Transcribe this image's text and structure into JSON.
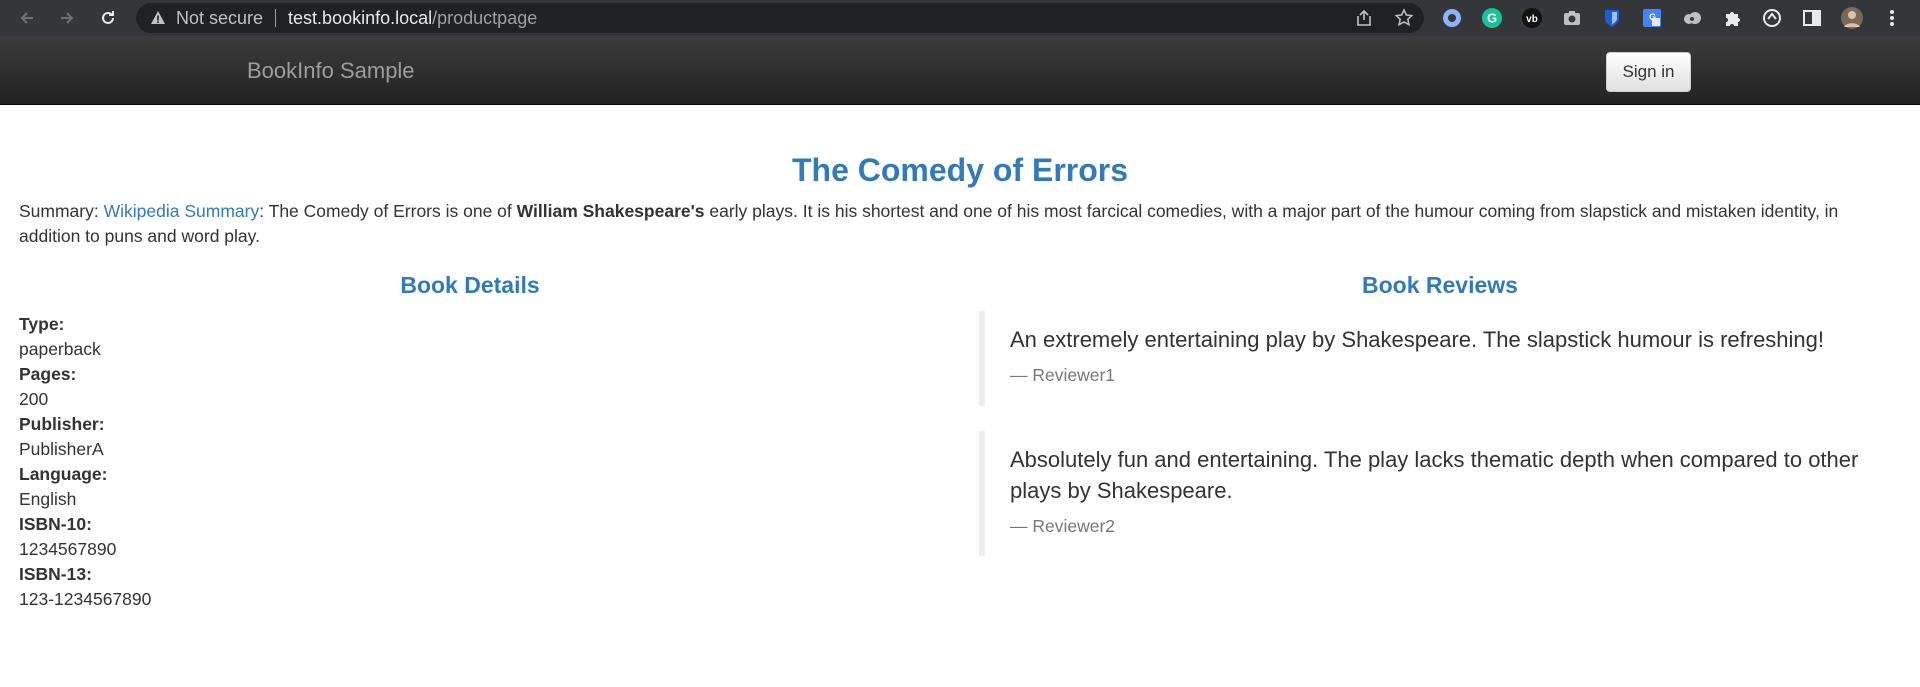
{
  "browser": {
    "not_secure_label": "Not secure",
    "url_host": "test.bookinfo.local",
    "url_path": "/productpage",
    "extension_icons": [
      "privacy-badger-icon",
      "grammarly-icon",
      "vidiq-icon",
      "camera-icon",
      "bitwarden-icon",
      "google-translate-icon",
      "cloud-extension-icon",
      "puzzle-extensions-icon",
      "sync-icon",
      "side-panel-icon",
      "profile-avatar",
      "more-menu-icon"
    ]
  },
  "navbar": {
    "brand": "BookInfo Sample",
    "sign_in_label": "Sign in"
  },
  "product": {
    "title": "The Comedy of Errors",
    "summary_prefix": "Summary: ",
    "summary_link": "Wikipedia Summary",
    "summary_text_1": ": The Comedy of Errors is one of ",
    "summary_bold": "William Shakespeare's",
    "summary_text_2": " early plays. It is his shortest and one of his most farcical comedies, with a major part of the humour coming from slapstick and mistaken identity, in addition to puns and word play."
  },
  "details": {
    "heading": "Book Details",
    "items": [
      {
        "label": "Type:",
        "value": "paperback"
      },
      {
        "label": "Pages:",
        "value": "200"
      },
      {
        "label": "Publisher:",
        "value": "PublisherA"
      },
      {
        "label": "Language:",
        "value": "English"
      },
      {
        "label": "ISBN-10:",
        "value": "1234567890"
      },
      {
        "label": "ISBN-13:",
        "value": "123-1234567890"
      }
    ]
  },
  "reviews": {
    "heading": "Book Reviews",
    "items": [
      {
        "text": "An extremely entertaining play by Shakespeare. The slapstick humour is refreshing!",
        "author": "— Reviewer1"
      },
      {
        "text": "Absolutely fun and entertaining. The play lacks thematic depth when compared to other plays by Shakespeare.",
        "author": "— Reviewer2"
      }
    ]
  },
  "colors": {
    "link": "#337ab7",
    "navbar_bg": "#222222",
    "chrome_bg": "#35363a"
  }
}
